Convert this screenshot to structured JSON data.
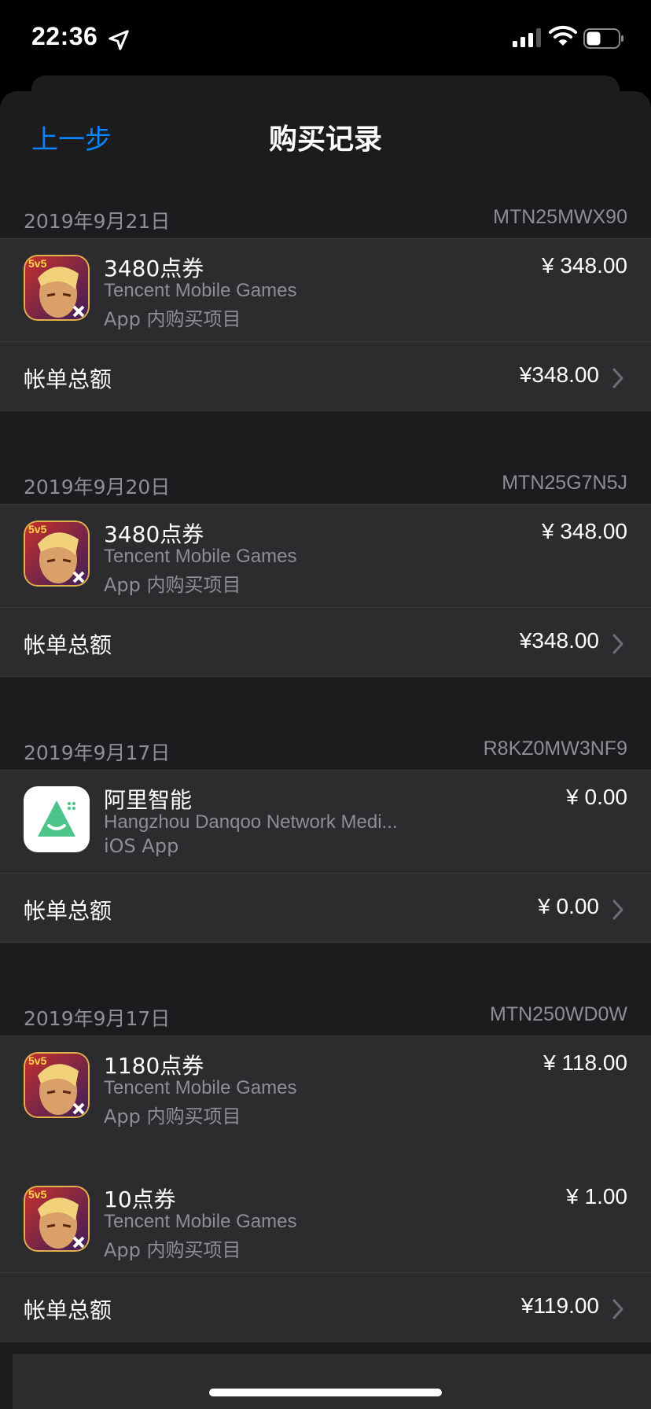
{
  "status": {
    "time": "22:36"
  },
  "nav": {
    "back_label": "上一步",
    "title": "购买记录"
  },
  "groups": [
    {
      "date": "2019年9月21日",
      "order_id": "MTN25MWX90",
      "items": [
        {
          "name": "3480点券",
          "developer": "Tencent Mobile Games",
          "type": "App 内购买项目",
          "price": "¥ 348.00",
          "icon": "honor-of-kings-icon"
        }
      ],
      "total_label": "帐单总额",
      "total_value": "¥348.00"
    },
    {
      "date": "2019年9月20日",
      "order_id": "MTN25G7N5J",
      "items": [
        {
          "name": "3480点券",
          "developer": "Tencent Mobile Games",
          "type": "App 内购买项目",
          "price": "¥ 348.00",
          "icon": "honor-of-kings-icon"
        }
      ],
      "total_label": "帐单总额",
      "total_value": "¥348.00"
    },
    {
      "date": "2019年9月17日",
      "order_id": "R8KZ0MW3NF9",
      "items": [
        {
          "name": "阿里智能",
          "developer": "Hangzhou Danqoo Network Medi...",
          "type": "iOS App",
          "price": "¥ 0.00",
          "icon": "ali-smart-icon"
        }
      ],
      "total_label": "帐单总额",
      "total_value": "¥ 0.00"
    },
    {
      "date": "2019年9月17日",
      "order_id": "MTN250WD0W",
      "items": [
        {
          "name": "1180点券",
          "developer": "Tencent Mobile Games",
          "type": "App 内购买项目",
          "price": "¥ 118.00",
          "icon": "honor-of-kings-icon"
        },
        {
          "name": "10点券",
          "developer": "Tencent Mobile Games",
          "type": "App 内购买项目",
          "price": "¥ 1.00",
          "icon": "honor-of-kings-icon"
        }
      ],
      "total_label": "帐单总额",
      "total_value": "¥119.00"
    }
  ],
  "colors": {
    "accent": "#0a84ff",
    "background": "#1c1c1e",
    "card": "#2c2c2e",
    "secondary_text": "#8e8e93"
  }
}
